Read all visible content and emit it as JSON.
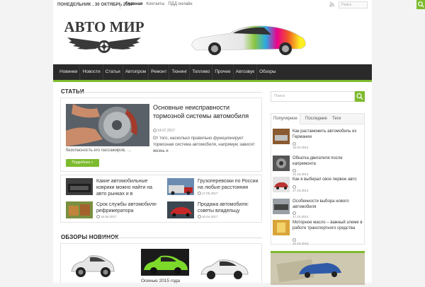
{
  "topbar": {
    "date": "ПОНЕДЕЛЬНИК , 30 ОКТЯБРЬ 2017",
    "nav": [
      "Главная",
      "Контакты",
      "ПДД онлайн"
    ],
    "search_placeholder": "Поиск"
  },
  "logo": {
    "text": "АВТО МИР"
  },
  "main_nav": [
    "Новинки",
    "Новости",
    "Статьи",
    "Автопром",
    "Ремонт",
    "Тюнинг",
    "Топливо",
    "Прочее",
    "Автозвук",
    "Обзоры"
  ],
  "articles": {
    "title": "СТАТЬИ",
    "featured": {
      "title": "Основные неисправности тормозной системы автомобиля",
      "date": "14.07.2017",
      "excerpt": "От того, насколько правильно функционирует тормозная система автомобиля, напрямую зависят жизнь и",
      "excerpt_cont": "безопасность его пассажиров, …",
      "more_label": "Подробнее »"
    },
    "items": [
      {
        "title": "Какие автомобильные коврики можно найти на авто рынках и в",
        "date": ""
      },
      {
        "title": "Грузоперевозки по России на любые расстояния",
        "date": "17.05.2017"
      },
      {
        "title": "Срок службы автомобиля-рефрижератора",
        "date": "16.05.2017"
      },
      {
        "title": "Продажа автомобиля: советы владельцу",
        "date": "10.04.2017"
      }
    ]
  },
  "reviews": {
    "title": "ОБЗОРЫ НОВИНОК",
    "caption": "Осенью 2015 года"
  },
  "sidebar": {
    "search_placeholder": "Поиск",
    "tabs": [
      "Популярное",
      "Последние",
      "Теги"
    ],
    "items": [
      {
        "title": "Как растаможить автомобиль из Германии",
        "date": "16.04.2014"
      },
      {
        "title": "Обкатка двигателя после капремонта",
        "date": "12.10.2014"
      },
      {
        "title": "Как я выбирал свое первое авто",
        "date": "17.10.2014"
      },
      {
        "title": "Особенности выбора нового автомобиля",
        "date": "17.10.2014"
      },
      {
        "title": "Моторное масло – важный элеме в работе транспортного средства",
        "date": "10.10.2015"
      }
    ]
  },
  "colors": {
    "accent": "#7dbb2e",
    "nav_bg": "#2a2a2a"
  }
}
